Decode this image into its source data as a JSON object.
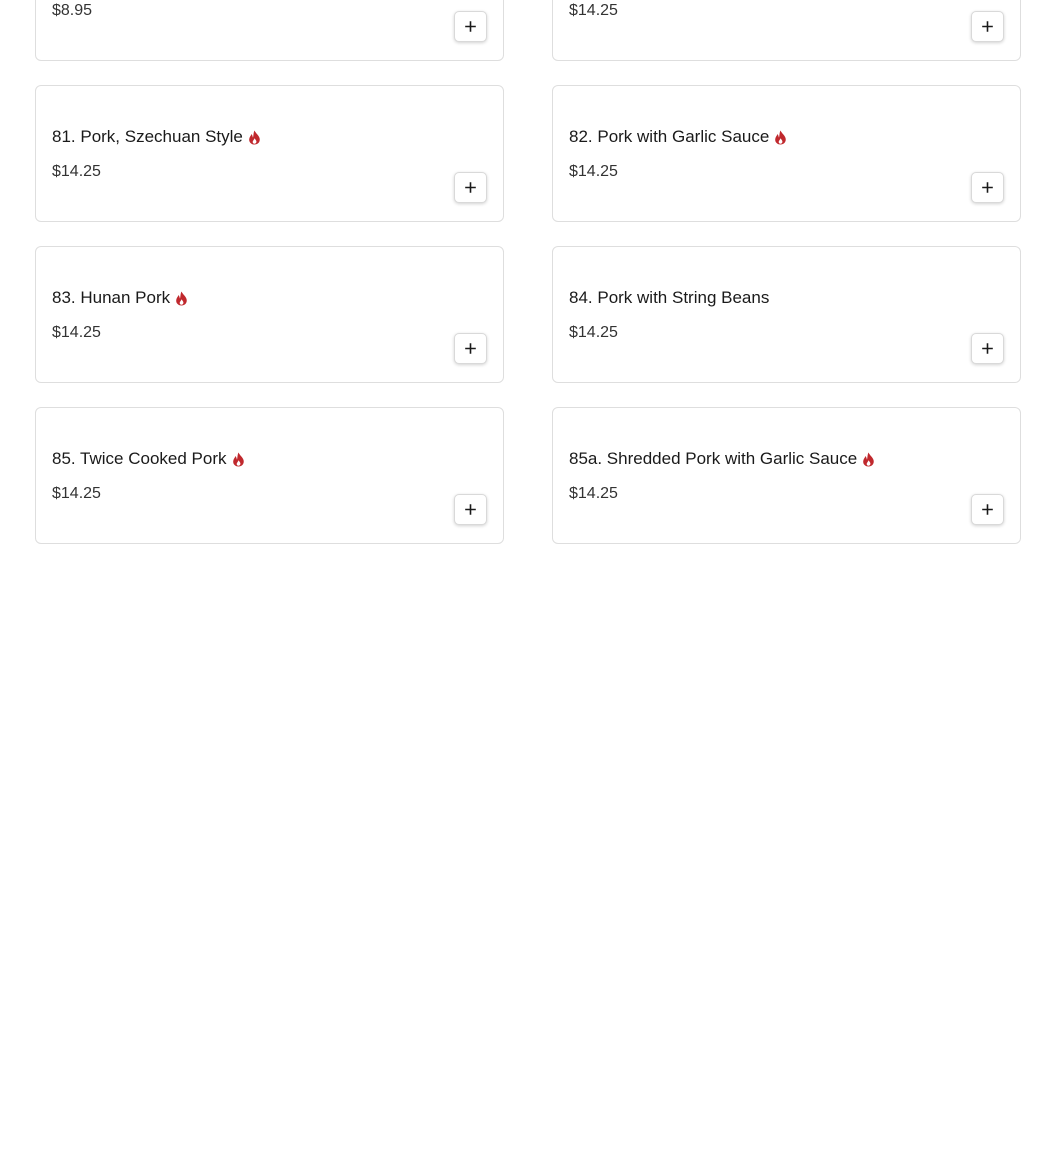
{
  "colors": {
    "spicy_icon": "#c0282d",
    "card_border": "#dedede",
    "text": "#1a1a1a"
  },
  "menu_items": [
    {
      "name": "",
      "price": "$8.95",
      "spicy": false,
      "add_icon": "plus-icon"
    },
    {
      "name": "",
      "price": "$14.25",
      "spicy": false,
      "add_icon": "plus-icon"
    },
    {
      "name": "81. Pork, Szechuan Style",
      "price": "$14.25",
      "spicy": true,
      "add_icon": "plus-icon"
    },
    {
      "name": "82. Pork with Garlic Sauce",
      "price": "$14.25",
      "spicy": true,
      "add_icon": "plus-icon"
    },
    {
      "name": "83. Hunan Pork",
      "price": "$14.25",
      "spicy": true,
      "add_icon": "plus-icon"
    },
    {
      "name": "84. Pork with String Beans",
      "price": "$14.25",
      "spicy": false,
      "add_icon": "plus-icon"
    },
    {
      "name": "85. Twice Cooked Pork",
      "price": "$14.25",
      "spicy": true,
      "add_icon": "plus-icon"
    },
    {
      "name": "85a. Shredded Pork with Garlic Sauce",
      "price": "$14.25",
      "spicy": true,
      "add_icon": "plus-icon"
    }
  ]
}
